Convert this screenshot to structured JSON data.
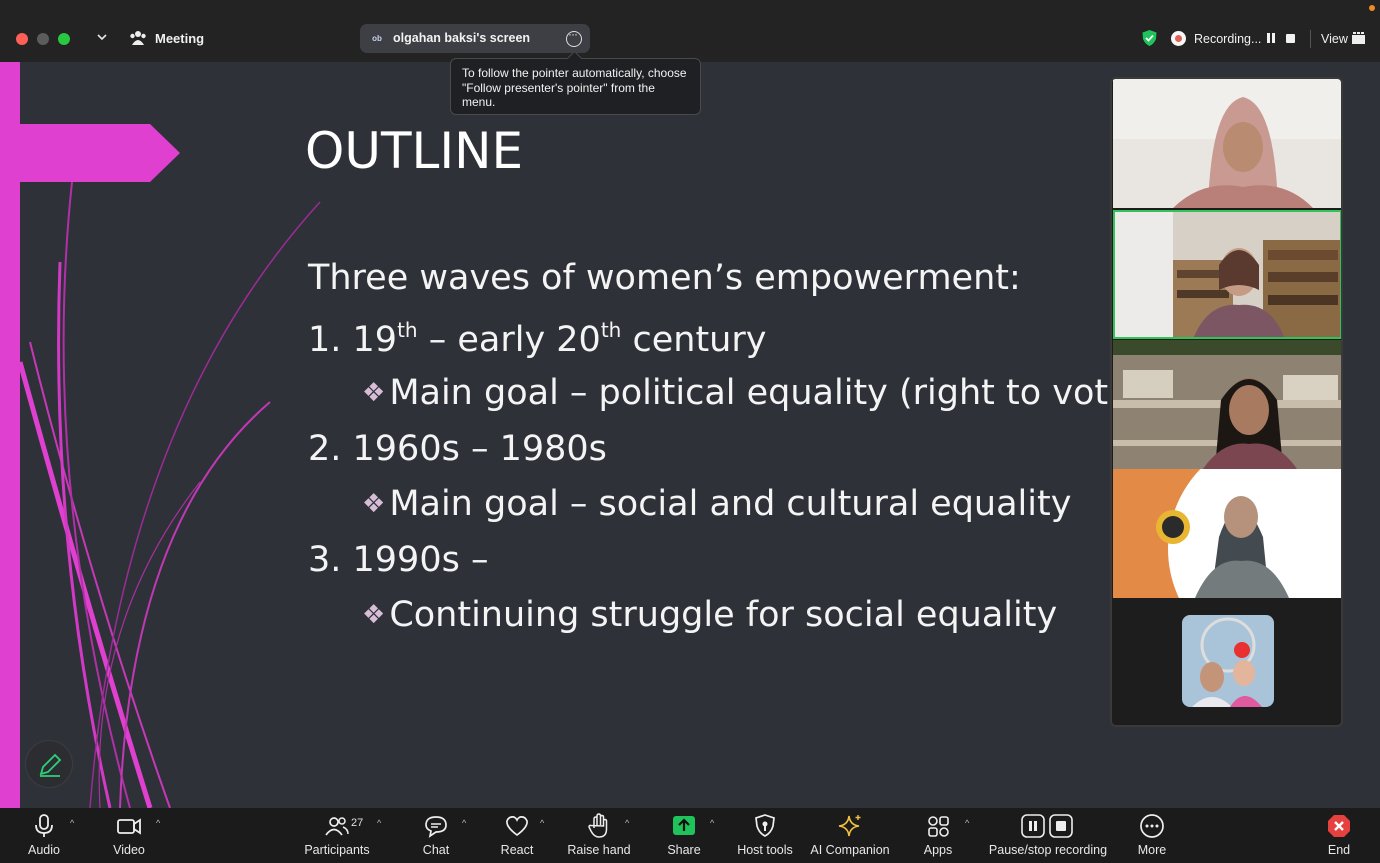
{
  "titlebar": {
    "meeting_label": "Meeting",
    "shared_screen_initials": "ob",
    "shared_screen_label": "olgahan baksi's screen",
    "tooltip_text": "To follow the pointer automatically, choose \"Follow presenter's pointer\" from the menu.",
    "recording_label": "Recording...",
    "view_label": "View"
  },
  "slide": {
    "title": "OUTLINE",
    "heading": "Three waves of women’s empowerment:",
    "wave1_prefix": "1. 19",
    "wave1_sup1": "th",
    "wave1_mid": " – early 20",
    "wave1_sup2": "th",
    "wave1_suffix": " century",
    "wave1_goal": "Main goal – political equality (right to vote)",
    "wave2": "2. 1960s – 1980s",
    "wave2_goal": "Main goal – social and cultural equality",
    "wave3": "3. 1990s –",
    "wave3_goal": "Continuing struggle for social equality",
    "bullet_symbol": "❖"
  },
  "toolbar": {
    "audio": "Audio",
    "video": "Video",
    "participants": "Participants",
    "participants_count": "27",
    "chat": "Chat",
    "react": "React",
    "raise_hand": "Raise hand",
    "share": "Share",
    "host_tools": "Host tools",
    "ai_companion": "AI Companion",
    "apps": "Apps",
    "pause_stop_recording": "Pause/stop recording",
    "more": "More",
    "end": "End"
  },
  "colors": {
    "slide_bg": "#2e3138",
    "accent_magenta": "#e040d0",
    "share_green": "#1fc25b",
    "end_red": "#e4413f",
    "active_speaker_border": "#33c25a"
  },
  "icons": [
    "chevron-down-icon",
    "meeting-icon",
    "more-options-icon",
    "shield-icon",
    "recording-icon",
    "pause-icon",
    "stop-icon",
    "view-grid-icon",
    "pencil-icon",
    "microphone-icon",
    "camera-icon",
    "participants-icon",
    "chat-icon",
    "heart-icon",
    "hand-icon",
    "share-arrow-icon",
    "host-shield-icon",
    "sparkle-icon",
    "apps-icon",
    "pause-recording-icon",
    "stop-recording-icon",
    "more-dots-icon",
    "end-x-icon"
  ]
}
